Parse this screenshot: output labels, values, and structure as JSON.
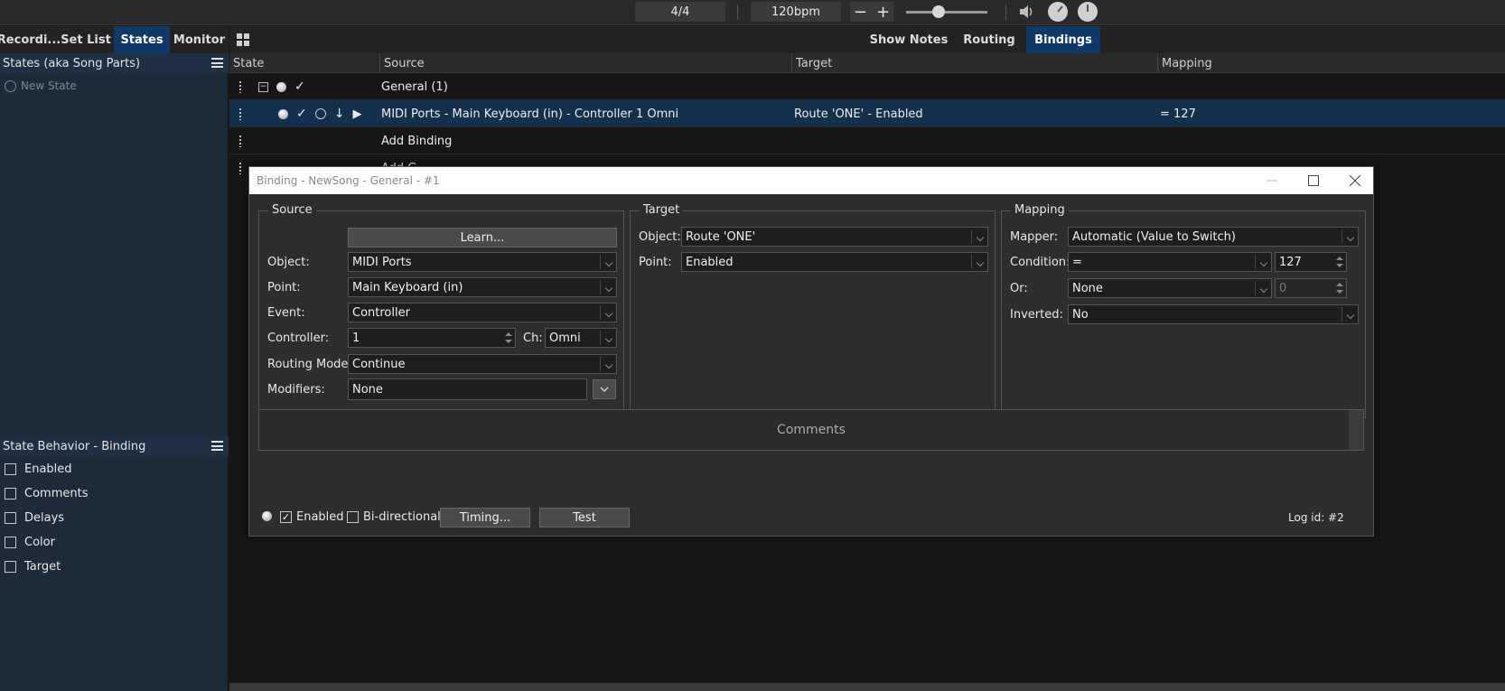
{
  "transport": {
    "time_signature": "4/4",
    "tempo": "120bpm",
    "minus_glyph": "−",
    "plus_glyph": "+",
    "volume_level": 0.4
  },
  "left_tabs": [
    "Recordi...",
    "Set List",
    "States",
    "Monitor"
  ],
  "left_active_tab": "States",
  "states_panel": {
    "title": "States (aka Song Parts)",
    "new_state": "New State"
  },
  "behavior_panel": {
    "title": "State Behavior - Binding",
    "items": [
      "Enabled",
      "Comments",
      "Delays",
      "Color",
      "Target"
    ]
  },
  "main_tabs": [
    "Show Notes",
    "Routing",
    "Bindings"
  ],
  "main_active_tab": "Bindings",
  "columns": [
    "State",
    "Source",
    "Target",
    "Mapping"
  ],
  "rows": {
    "group": {
      "source": "General (1)"
    },
    "binding": {
      "source": "MIDI Ports - Main Keyboard (in) - Controller 1 Omni",
      "target": "Route 'ONE' - Enabled",
      "mapping": "= 127"
    },
    "add_binding": "Add Binding",
    "add_group_partial": "Add G"
  },
  "dialog": {
    "title": "Binding - NewSong - General - #1",
    "source": {
      "legend": "Source",
      "learn": "Learn...",
      "object_label": "Object:",
      "object": "MIDI Ports",
      "point_label": "Point:",
      "point": "Main Keyboard (in)",
      "event_label": "Event:",
      "event": "Controller",
      "controller_label": "Controller:",
      "controller": "1",
      "ch_label": "Ch:",
      "ch": "Omni",
      "routing_label": "Routing Mode:",
      "routing": "Continue",
      "modifiers_label": "Modifiers:",
      "modifiers": "None"
    },
    "target": {
      "legend": "Target",
      "object_label": "Object:",
      "object": "Route 'ONE'",
      "point_label": "Point:",
      "point": "Enabled"
    },
    "mapping": {
      "legend": "Mapping",
      "mapper_label": "Mapper:",
      "mapper": "Automatic (Value to Switch)",
      "condition_label": "Condition:",
      "condition": "=",
      "condition_value": "127",
      "or_label": "Or:",
      "or": "None",
      "or_value": "0",
      "inverted_label": "Inverted:",
      "inverted": "No"
    },
    "comments_placeholder": "Comments",
    "footer": {
      "enabled": "Enabled",
      "bidirectional": "Bi-directional",
      "timing": "Timing...",
      "test": "Test",
      "log_id": "Log id: #2"
    }
  }
}
